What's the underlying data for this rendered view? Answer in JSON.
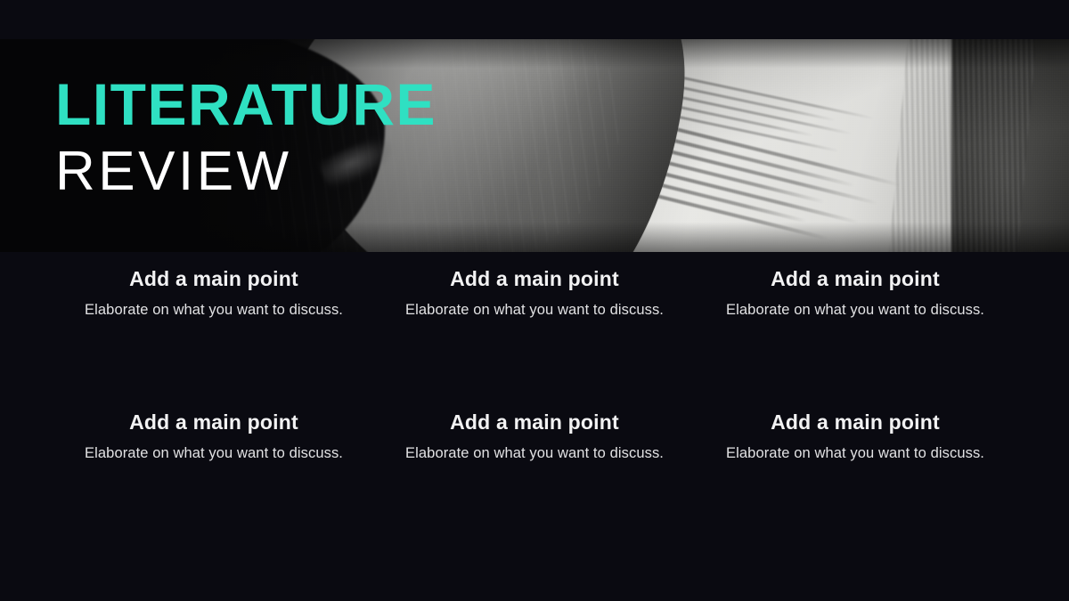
{
  "slide": {
    "background_color": "#0a0a11",
    "accent_color": "#2fe0c2",
    "text_color": "#ffffff"
  },
  "header": {
    "title_line1": "LITERATURE",
    "title_line2": "REVIEW",
    "hero_image_alt": "black-and-white photograph of an open book with curled pages"
  },
  "points": [
    {
      "title": "Add a main point",
      "body": "Elaborate on what you want to discuss."
    },
    {
      "title": "Add a main point",
      "body": "Elaborate on what you want to discuss."
    },
    {
      "title": "Add a main point",
      "body": "Elaborate on what you want to discuss."
    },
    {
      "title": "Add a main point",
      "body": "Elaborate on what you want to discuss."
    },
    {
      "title": "Add a main point",
      "body": "Elaborate on what you want to discuss."
    },
    {
      "title": "Add a main point",
      "body": "Elaborate on what you want to discuss."
    }
  ]
}
